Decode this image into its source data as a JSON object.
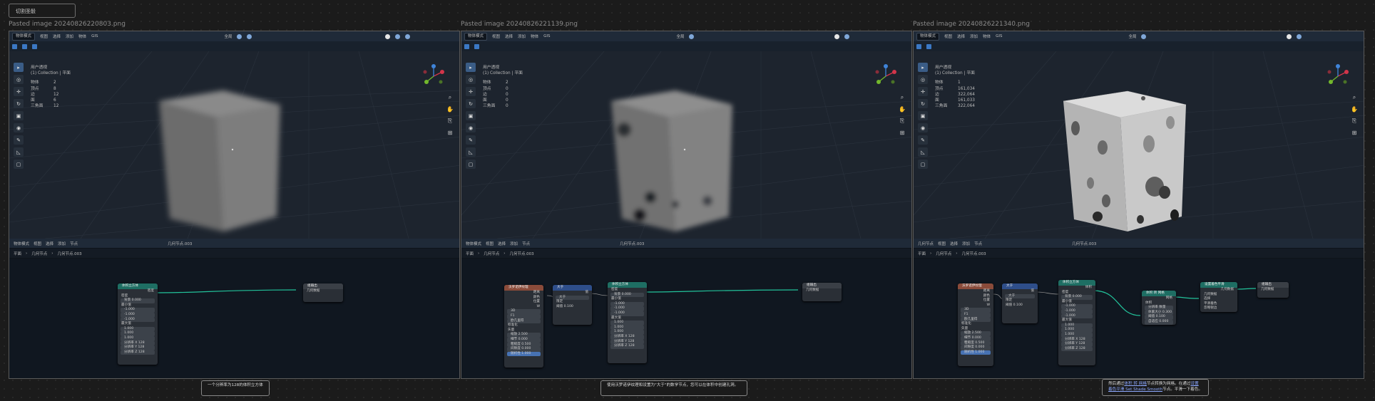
{
  "top_note": "切割圣骰",
  "panels": [
    {
      "title": "Pasted image 20240826220803.png",
      "header_mode": "物体模式",
      "header_menus": [
        "视图",
        "选择",
        "添加",
        "物体",
        "GIS"
      ],
      "header_right": [
        "全局"
      ],
      "viewport_info": [
        "用户透视",
        "(1) Collection | 平面"
      ],
      "stats": [
        [
          "物体",
          "2"
        ],
        [
          "顶点",
          "8"
        ],
        [
          "边",
          "12"
        ],
        [
          "面",
          "6"
        ],
        [
          "三角面",
          "12"
        ]
      ],
      "ne_editor": "物体模式",
      "ne_menus": [
        "视图",
        "选择",
        "添加",
        "节点"
      ],
      "ne_tree": "几何节点.003",
      "breadcrumb": [
        "平面",
        "几何节点",
        "几何节点.003"
      ],
      "caption": "一个分辨率为128的体积立方体",
      "nodes": [
        {
          "title": "体积立方体",
          "color": "#1e6e63",
          "rows": [
            "密度",
            "密度",
            "背景 0.000",
            "最小值",
            "-1.000",
            "-1.000",
            "-1.000",
            "最大值",
            "1.000",
            "1.000",
            "1.000",
            "分辨率 X 128",
            "分辨率 Y 128",
            "分辨率 Z 128"
          ]
        },
        {
          "title": "组输出",
          "color": "#3a3f46",
          "rows": [
            "几何数据"
          ]
        }
      ]
    },
    {
      "title": "Pasted image 20240826221139.png",
      "header_mode": "物体模式",
      "header_menus": [
        "视图",
        "选择",
        "添加",
        "物体",
        "GIS"
      ],
      "header_right": [
        "全局"
      ],
      "viewport_info": [
        "用户透视",
        "(1) Collection | 平面"
      ],
      "stats": [
        [
          "物体",
          "2"
        ],
        [
          "顶点",
          "0"
        ],
        [
          "边",
          "0"
        ],
        [
          "面",
          "0"
        ],
        [
          "三角面",
          "0"
        ]
      ],
      "ne_editor": "物体模式",
      "ne_menus": [
        "视图",
        "选择",
        "添加",
        "节点"
      ],
      "ne_tree": "几何节点.003",
      "breadcrumb": [
        "平面",
        "几何节点",
        "几何节点.003"
      ],
      "caption": "使用沃罗诺伊纹理和设置为\"大于\"的数学节点，您可以在体积中创建孔洞。",
      "nodes": [
        {
          "title": "沃罗诺伊纹理",
          "color": "#8a4b3a",
          "rows": [
            "距离",
            "颜色",
            "位置",
            "W",
            "3D",
            "F1",
            "欧几里得",
            "标准化",
            "矢量",
            "缩放 2.500",
            "细节 0.000",
            "粗糙度 0.500",
            "间隙度 0.000",
            "随机性 1.000"
          ]
        },
        {
          "title": "大于",
          "color": "#2e4e8a",
          "rows": [
            "值",
            "大于",
            "限定",
            "阈值 0.100"
          ]
        },
        {
          "title": "体积立方体",
          "color": "#1e6e63",
          "rows": [
            "密度",
            "背景 0.000",
            "最小值",
            "-1.000",
            "-1.000",
            "-1.000",
            "最大值",
            "1.000",
            "1.000",
            "1.000",
            "分辨率 X 128",
            "分辨率 Y 128",
            "分辨率 Z 128"
          ]
        },
        {
          "title": "组输出",
          "color": "#3a3f46",
          "rows": [
            "几何数据"
          ]
        }
      ]
    },
    {
      "title": "Pasted image 20240826221340.png",
      "header_mode": "物体模式",
      "header_menus": [
        "视图",
        "选择",
        "添加",
        "物体",
        "GIS"
      ],
      "header_right": [
        "全局"
      ],
      "viewport_info": [
        "用户透视",
        "(1) Collection | 平面"
      ],
      "stats": [
        [
          "物体",
          "1"
        ],
        [
          "顶点",
          "161,034"
        ],
        [
          "边",
          "322,064"
        ],
        [
          "面",
          "161,033"
        ],
        [
          "三角面",
          "322,064"
        ]
      ],
      "ne_editor": "几何节点",
      "ne_menus": [
        "视图",
        "选择",
        "添加",
        "节点"
      ],
      "ne_tree": "几何节点.003",
      "breadcrumb": [
        "平面",
        "几何节点",
        "几何节点.003"
      ],
      "caption_parts": [
        "然后通过",
        "体积 转 网格",
        "节点转换为网格。在通过",
        "设置着色平滑 Set Shade Smooth",
        "节点。平滑一下着色。"
      ],
      "nodes": [
        {
          "title": "沃罗诺伊纹理",
          "color": "#8a4b3a",
          "rows": [
            "距离",
            "颜色",
            "位置",
            "W",
            "3D",
            "F1",
            "欧几里得",
            "标准化",
            "矢量",
            "缩放 2.500",
            "细节 0.000",
            "粗糙度 0.500",
            "间隙度 0.000",
            "随机性 1.000"
          ]
        },
        {
          "title": "大于",
          "color": "#2e4e8a",
          "rows": [
            "值",
            "大于",
            "限定",
            "阈值 0.100"
          ]
        },
        {
          "title": "体积立方体",
          "color": "#1e6e63",
          "rows": [
            "体积",
            "密度",
            "背景 0.000",
            "最小值",
            "-1.000",
            "-1.000",
            "-1.000",
            "最大值",
            "1.000",
            "1.000",
            "1.000",
            "分辨率 X 128",
            "分辨率 Y 128",
            "分辨率 Z 128"
          ]
        },
        {
          "title": "体积 转 网格",
          "color": "#1e6e63",
          "rows": [
            "网格",
            "体积",
            "分辨率 数量",
            "体素大小 0.300",
            "阈值 0.100",
            "自适应 0.000"
          ]
        },
        {
          "title": "设置着色平滑",
          "color": "#1e6e63",
          "rows": [
            "几何数据",
            "几何数据",
            "选择",
            "平滑着色",
            "忽略锐边"
          ]
        },
        {
          "title": "组输出",
          "color": "#3a3f46",
          "rows": [
            "几何数据"
          ]
        }
      ]
    }
  ]
}
